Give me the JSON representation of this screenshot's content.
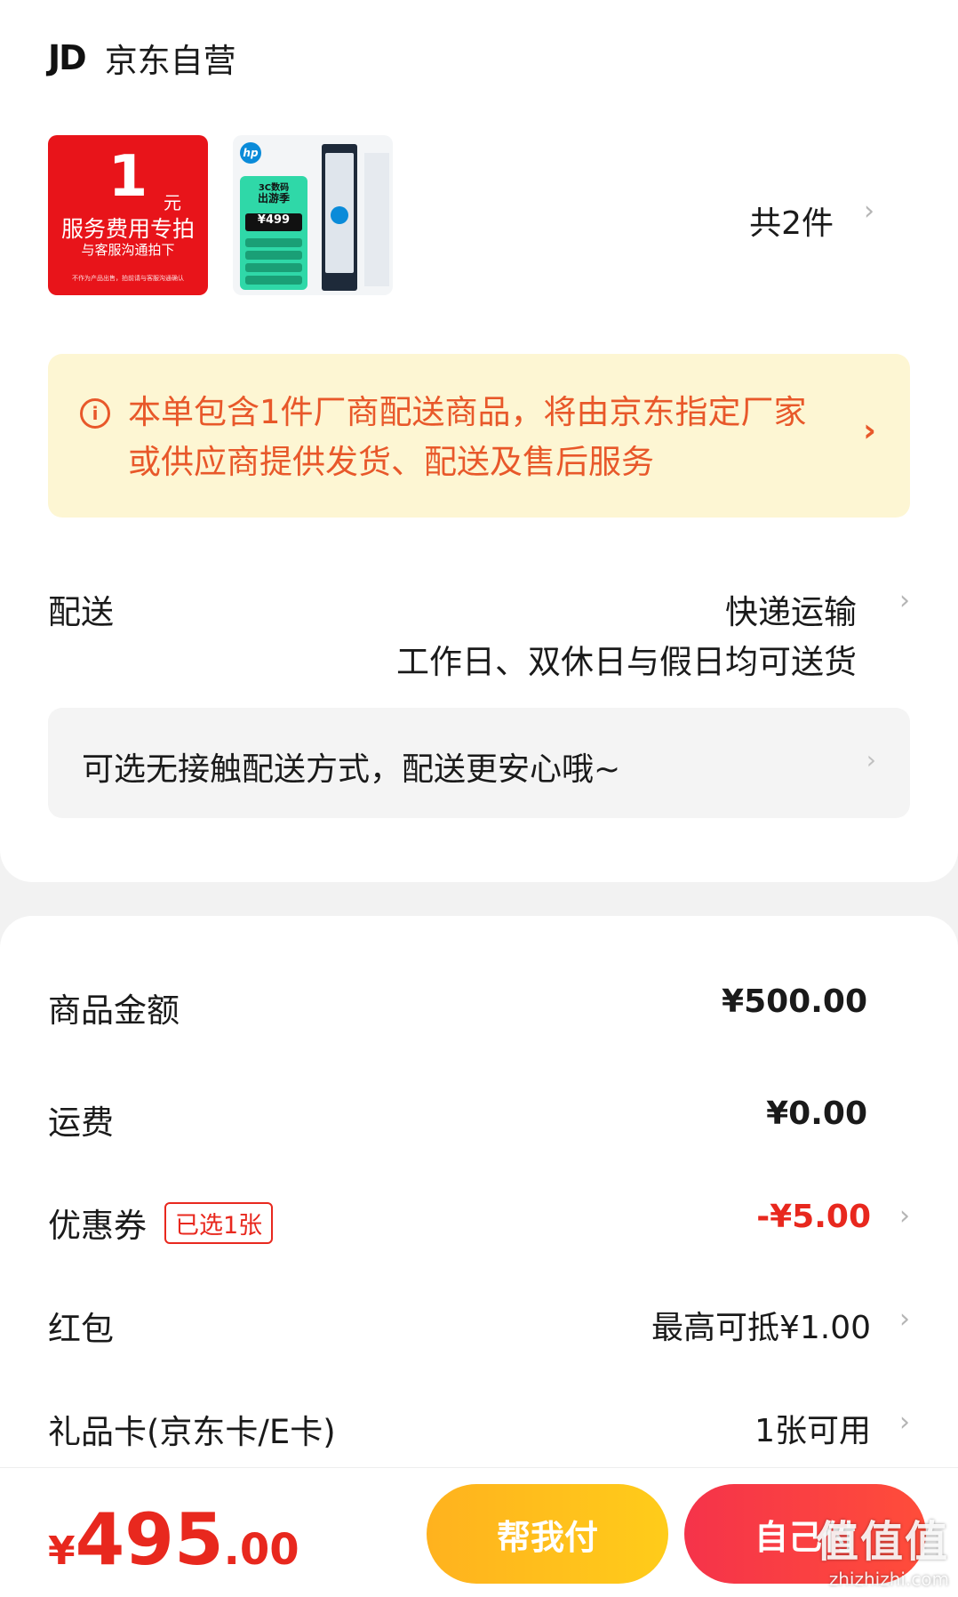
{
  "shop": {
    "logo": "JD",
    "name": "京东自营"
  },
  "products": {
    "service_thumb": {
      "big_num": "1",
      "unit": "元",
      "line1": "服务费用专拍",
      "line2": "与客服沟通拍下",
      "line3": "不作为产品出售，拍前请与客服沟通确认"
    },
    "ssd_thumb": {
      "brand_mark": "hp",
      "tag_top": "3C数码",
      "tag_title": "出游季",
      "price": "¥499"
    },
    "count": "共2件"
  },
  "notice": {
    "text": "本单包含1件厂商配送商品，将由京东指定厂家或供应商提供发货、配送及售后服务"
  },
  "shipping": {
    "label": "配送",
    "method": "快递运输",
    "schedule": "工作日、双休日与假日均可送货",
    "contactless": "可选无接触配送方式，配送更安心哦~"
  },
  "summary": {
    "goods_label": "商品金额",
    "goods_value": "¥500.00",
    "freight_label": "运费",
    "freight_value": "¥0.00",
    "coupon_label": "优惠券",
    "coupon_badge": "已选1张",
    "coupon_value": "-¥5.00",
    "redpacket_label": "红包",
    "redpacket_value": "最高可抵¥1.00",
    "giftcard_label": "礼品卡(京东卡/E卡)",
    "giftcard_value": "1张可用"
  },
  "footer": {
    "currency": "¥",
    "total_int": "495",
    "total_dec": ".00",
    "help_pay": "帮我付",
    "self_pay": "自己付",
    "watermark_big": "值值值",
    "watermark_small": "zhizhizhi.com"
  },
  "colors": {
    "accent_red": "#e8281e",
    "notice_orange": "#e8582a",
    "notice_bg": "#fdf6d3",
    "help_btn": "#ffbe1e",
    "self_btn": "#f5334a"
  },
  "icons": {
    "info": "info-icon",
    "chevron": "chevron-right-icon"
  }
}
